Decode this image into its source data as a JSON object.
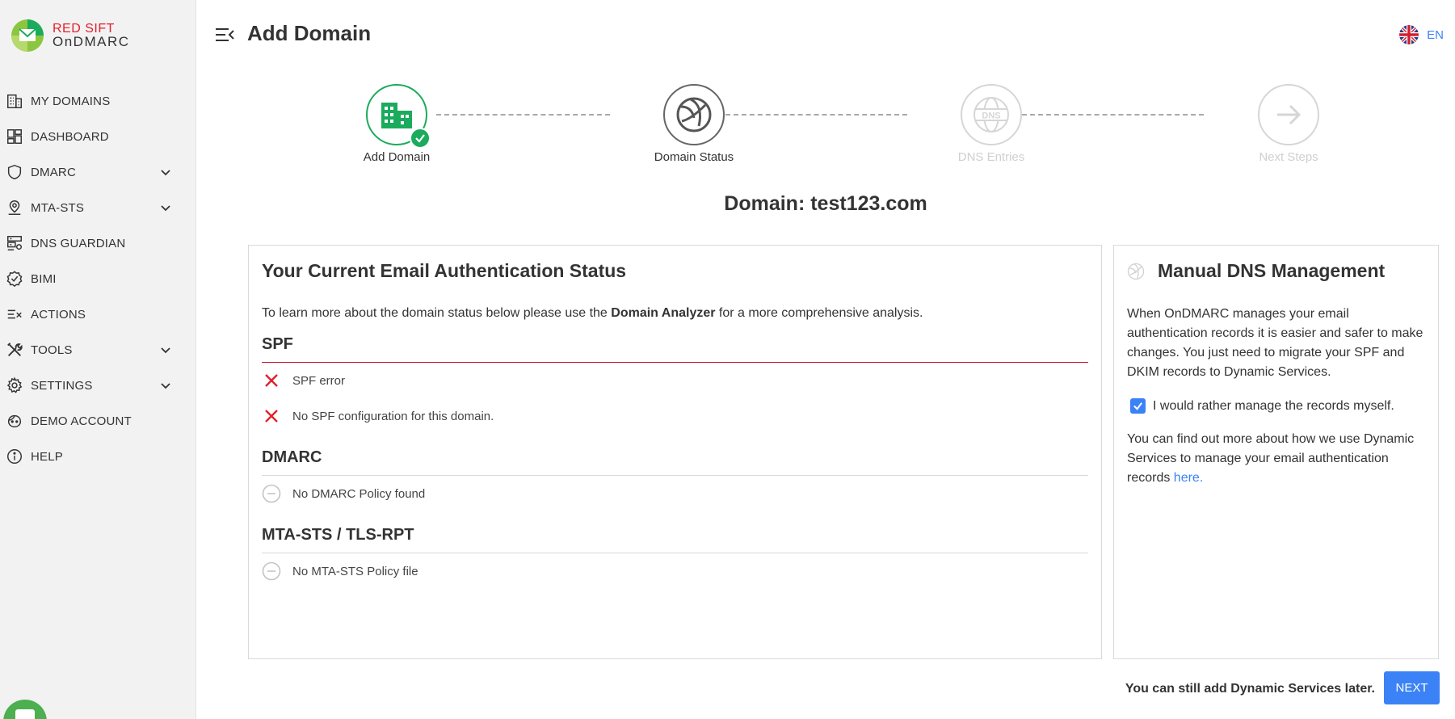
{
  "brand": {
    "name": "RED SIFT",
    "product": "OnDMARC",
    "accent": "#1bab5d",
    "error_color": "#c8102e",
    "link_color": "#3b82f6"
  },
  "sidebar": {
    "items": [
      {
        "label": "MY DOMAINS",
        "icon": "building-icon",
        "expandable": false
      },
      {
        "label": "DASHBOARD",
        "icon": "dashboard-icon",
        "expandable": false
      },
      {
        "label": "DMARC",
        "icon": "shield-icon",
        "expandable": true
      },
      {
        "label": "MTA-STS",
        "icon": "location-icon",
        "expandable": true
      },
      {
        "label": "DNS GUARDIAN",
        "icon": "server-icon",
        "expandable": false
      },
      {
        "label": "BIMI",
        "icon": "badge-check-icon",
        "expandable": false
      },
      {
        "label": "ACTIONS",
        "icon": "list-check-icon",
        "expandable": false
      },
      {
        "label": "TOOLS",
        "icon": "tools-icon",
        "expandable": true
      },
      {
        "label": "SETTINGS",
        "icon": "gear-icon",
        "expandable": true
      },
      {
        "label": "DEMO ACCOUNT",
        "icon": "face-icon",
        "expandable": false
      },
      {
        "label": "HELP",
        "icon": "info-icon",
        "expandable": false
      }
    ]
  },
  "header": {
    "title": "Add Domain",
    "language": "EN"
  },
  "stepper": {
    "steps": [
      {
        "label": "Add Domain",
        "state": "completed",
        "icon": "building-icon"
      },
      {
        "label": "Domain Status",
        "state": "current",
        "icon": "globe-icon"
      },
      {
        "label": "DNS Entries",
        "state": "disabled",
        "icon": "dns-globe-icon"
      },
      {
        "label": "Next Steps",
        "state": "disabled",
        "icon": "arrow-right-icon"
      }
    ]
  },
  "domain_heading": "Domain: test123.com",
  "status_card": {
    "title": "Your Current Email Authentication Status",
    "intro_before": "To learn more about the domain status below please use the ",
    "intro_bold": "Domain Analyzer",
    "intro_after": " for a more comprehensive analysis.",
    "sections": [
      {
        "title": "SPF",
        "state": "error",
        "rows": [
          {
            "text": "SPF error",
            "status": "error"
          },
          {
            "text": "No SPF configuration for this domain.",
            "status": "error"
          }
        ]
      },
      {
        "title": "DMARC",
        "state": "none",
        "rows": [
          {
            "text": "No DMARC Policy found",
            "status": "none"
          }
        ]
      },
      {
        "title": "MTA-STS / TLS-RPT",
        "state": "none",
        "rows": [
          {
            "text": "No MTA-STS Policy file",
            "status": "none"
          }
        ]
      }
    ]
  },
  "dns_card": {
    "title": "Manual DNS Management",
    "paragraph1": "When OnDMARC manages your email authentication records it is easier and safer to make changes. You just need to migrate your SPF and DKIM records to Dynamic Services.",
    "checkbox_label": "I would rather manage the records myself.",
    "checkbox_checked": true,
    "paragraph2": "You can find out more about how we use Dynamic Services to manage your email authentication records ",
    "link_text": "here."
  },
  "footer": {
    "note": "You can still add Dynamic Services later.",
    "next_label": "NEXT"
  }
}
